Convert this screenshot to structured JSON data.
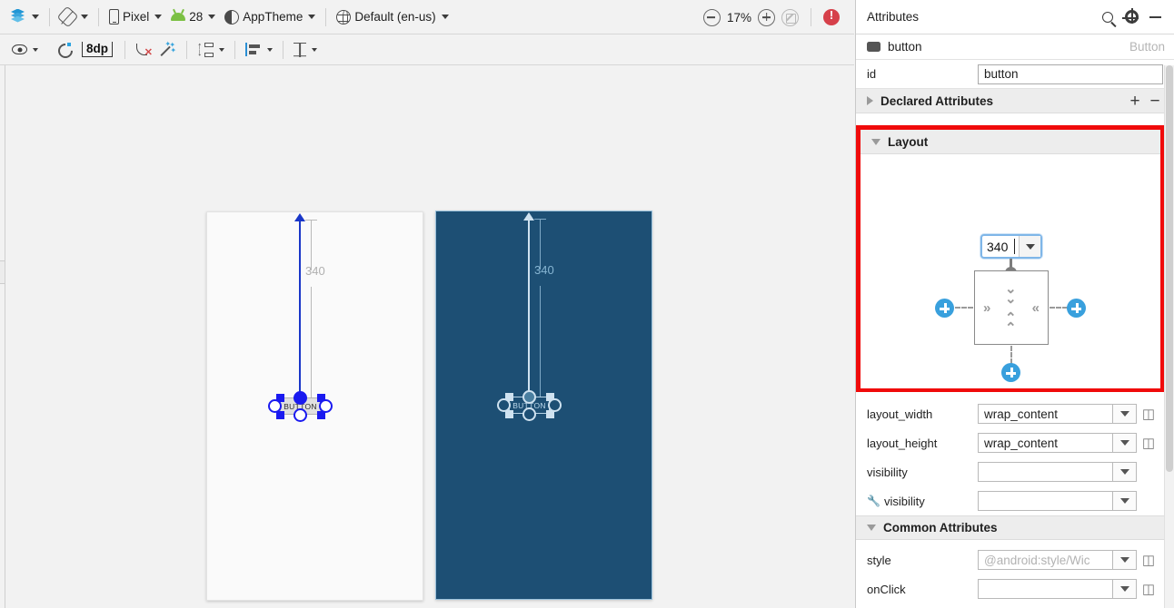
{
  "toolbar_primary": {
    "design_mode": {
      "label": "",
      "icon": "layers-icon"
    },
    "orientation": {
      "label": "",
      "icon": "rotate-icon"
    },
    "device": {
      "label": "Pixel",
      "icon": "phone-icon"
    },
    "api_level": {
      "label": "28",
      "icon": "android-icon"
    },
    "theme": {
      "label": "AppTheme",
      "icon": "theme-icon"
    },
    "locale": {
      "label": "Default (en-us)",
      "icon": "globe-icon"
    },
    "zoom_out": {
      "icon": "zoom-out-icon"
    },
    "zoom_value": "17%",
    "zoom_in": {
      "icon": "zoom-in-icon"
    },
    "zoom_fit": {
      "icon": "zoom-fit-icon"
    },
    "error_badge": {
      "icon": "error-icon",
      "color": "#d6404a"
    }
  },
  "toolbar_secondary": {
    "view_options": {
      "icon": "eye-icon"
    },
    "autoconnect": {
      "icon": "magnet-icon"
    },
    "default_margin": "8dp",
    "clear_constraints": {
      "icon": "clear-constraints-icon"
    },
    "infer_constraints": {
      "icon": "magic-wand-icon"
    },
    "pack": {
      "icon": "pack-icon"
    },
    "align": {
      "icon": "align-icon"
    },
    "guidelines": {
      "icon": "guideline-icon"
    }
  },
  "canvas": {
    "design_surface": {
      "name": "design-preview"
    },
    "blueprint_surface": {
      "name": "blueprint-preview"
    },
    "widget_label": "BUTTON",
    "constraint_margin_label": "340"
  },
  "attributes": {
    "header": {
      "title": "Attributes",
      "search_icon": "search-icon",
      "settings_icon": "gear-icon",
      "minimize_icon": "minimize-icon"
    },
    "component": {
      "name": "button",
      "type": "Button"
    },
    "id_row": {
      "label": "id",
      "value": "button"
    },
    "declared_section": {
      "title": "Declared Attributes",
      "add_label": "+",
      "remove_label": "−",
      "expanded": false
    },
    "layout_section": {
      "title": "Layout",
      "expanded": true,
      "highlight_color": "#f00b0b",
      "constraint_widget": {
        "top_margin_value": "340",
        "top_margin_dropdown": "chevron-down-icon",
        "left_anchor": "add-constraint-icon",
        "right_anchor": "add-constraint-icon",
        "bottom_anchor": "add-constraint-icon",
        "top_connected": true
      }
    },
    "rows": [
      {
        "label": "layout_width",
        "value": "wrap_content",
        "placeholder": "",
        "has_dropdown": true,
        "has_link": true,
        "has_wrench": false
      },
      {
        "label": "layout_height",
        "value": "wrap_content",
        "placeholder": "",
        "has_dropdown": true,
        "has_link": true,
        "has_wrench": false
      },
      {
        "label": "visibility",
        "value": "",
        "placeholder": "",
        "has_dropdown": true,
        "has_link": false,
        "has_wrench": false
      },
      {
        "label": "visibility",
        "value": "",
        "placeholder": "",
        "has_dropdown": true,
        "has_link": false,
        "has_wrench": true
      }
    ],
    "common_section": {
      "title": "Common Attributes",
      "expanded": true
    },
    "common_rows": [
      {
        "label": "style",
        "value": "",
        "placeholder": "@android:style/Wiс",
        "has_dropdown": true,
        "has_link": true,
        "has_wrench": false
      },
      {
        "label": "onClick",
        "value": "",
        "placeholder": "",
        "has_dropdown": true,
        "has_link": true,
        "has_wrench": false
      }
    ]
  }
}
